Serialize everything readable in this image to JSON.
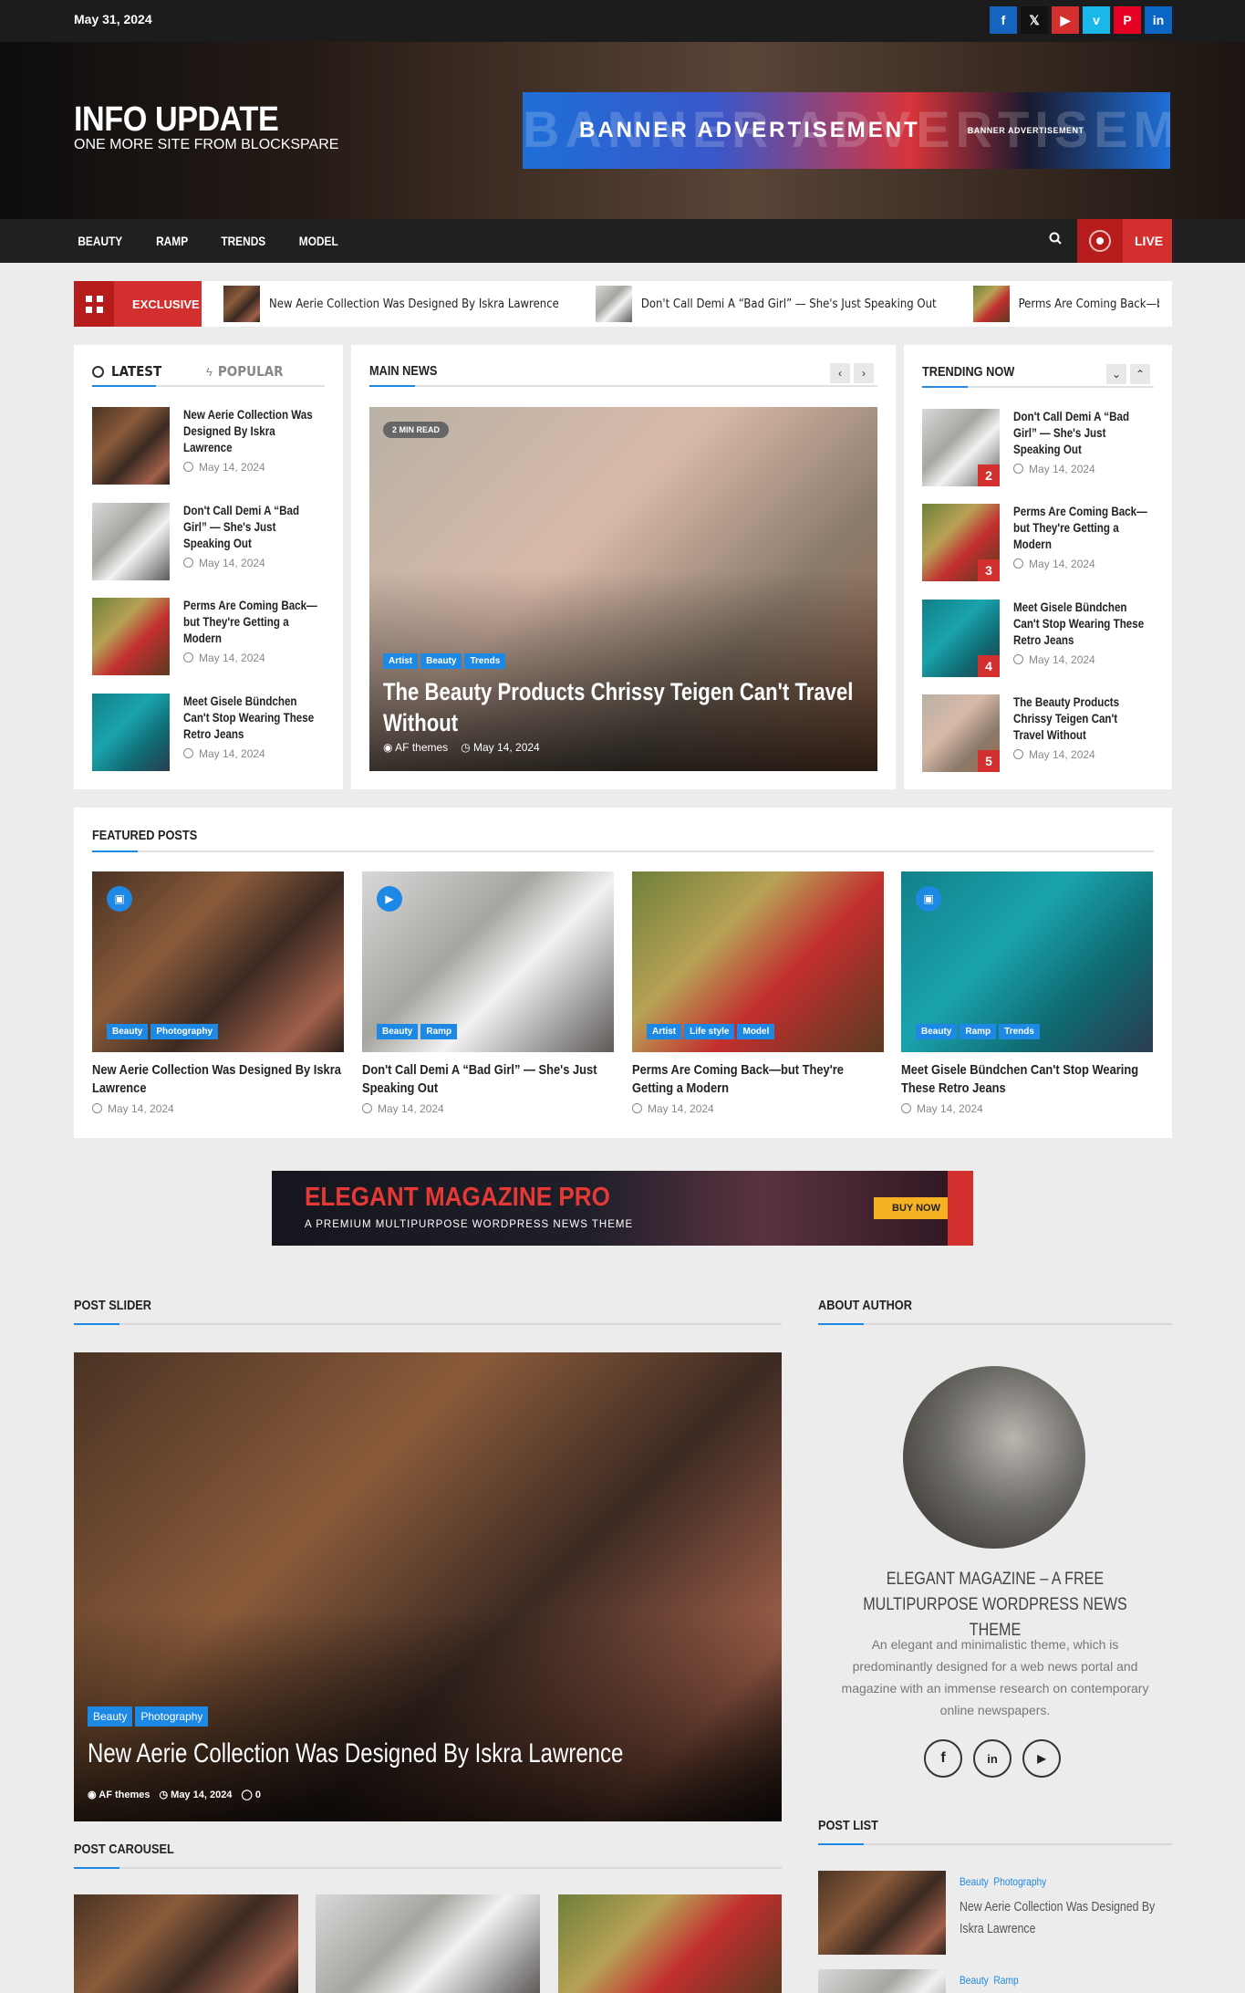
{
  "topbar": {
    "date": "May 31, 2024",
    "socials": [
      {
        "icon": "facebook-icon",
        "glyph": "f",
        "color": "#1565c0"
      },
      {
        "icon": "x-icon",
        "glyph": "𝕏",
        "color": "#111111"
      },
      {
        "icon": "youtube-icon",
        "glyph": "▶",
        "color": "#d32f2f"
      },
      {
        "icon": "vimeo-icon",
        "glyph": "v",
        "color": "#1ab7ea"
      },
      {
        "icon": "pinterest-icon",
        "glyph": "P",
        "color": "#e60023"
      },
      {
        "icon": "linkedin-icon",
        "glyph": "in",
        "color": "#0a66c2"
      }
    ]
  },
  "header": {
    "site_title": "INFO UPDATE",
    "tagline": "ONE MORE SITE FROM BLOCKSPARE",
    "banner": {
      "main": "BANNER ADVERTISEMENT",
      "small": "BANNER ADVERTISEMENT",
      "ghost": "BANNER ADVERTISEME"
    }
  },
  "nav": {
    "items": [
      "BEAUTY",
      "RAMP",
      "TRENDS",
      "MODEL"
    ],
    "live_label": "LIVE"
  },
  "exclusive": {
    "label": "EXCLUSIVE",
    "items": [
      "New Aerie Collection Was Designed By Iskra Lawrence",
      "Don't Call Demi A “Bad Girl” — She's Just Speaking Out",
      "Perms Are Coming Back—but They're Getting a Modern"
    ]
  },
  "latest": {
    "tab_latest": "LATEST",
    "tab_popular": "POPULAR",
    "items": [
      {
        "title": "New Aerie Collection Was Designed By Iskra Lawrence",
        "date": "May 14, 2024"
      },
      {
        "title": "Don't Call Demi A “Bad Girl” — She's Just Speaking Out",
        "date": "May 14, 2024"
      },
      {
        "title": "Perms Are Coming Back—but They're Getting a Modern",
        "date": "May 14, 2024"
      },
      {
        "title": "Meet Gisele Bündchen Can't Stop Wearing These Retro Jeans",
        "date": "May 14, 2024"
      }
    ]
  },
  "main_news": {
    "heading": "MAIN NEWS",
    "read_badge": "2 MIN READ",
    "tags": [
      "Artist",
      "Beauty",
      "Trends"
    ],
    "title": "The Beauty Products Chrissy Teigen Can't Travel Without",
    "author": "AF themes",
    "date": "May 14, 2024"
  },
  "trending": {
    "heading": "TRENDING NOW",
    "items": [
      {
        "num": "2",
        "title": "Don't Call Demi A “Bad Girl” — She's Just Speaking Out",
        "date": "May 14, 2024"
      },
      {
        "num": "3",
        "title": "Perms Are Coming Back—but They're Getting a Modern",
        "date": "May 14, 2024"
      },
      {
        "num": "4",
        "title": "Meet Gisele Bündchen Can't Stop Wearing These Retro Jeans",
        "date": "May 14, 2024"
      },
      {
        "num": "5",
        "title": "The Beauty Products Chrissy Teigen Can't Travel Without",
        "date": "May 14, 2024"
      }
    ]
  },
  "featured": {
    "heading": "FEATURED POSTS",
    "items": [
      {
        "tags": [
          "Beauty",
          "Photography"
        ],
        "title": "New Aerie Collection Was Designed By Iskra Lawrence",
        "date": "May 14, 2024",
        "icon": "image-icon",
        "glyph": "▣"
      },
      {
        "tags": [
          "Beauty",
          "Ramp"
        ],
        "title": "Don't Call Demi A “Bad Girl” — She's Just Speaking Out",
        "date": "May 14, 2024",
        "icon": "play-icon",
        "glyph": "▶"
      },
      {
        "tags": [
          "Artist",
          "Life style",
          "Model"
        ],
        "title": "Perms Are Coming Back—but They're Getting a Modern",
        "date": "May 14, 2024",
        "icon": "",
        "glyph": ""
      },
      {
        "tags": [
          "Beauty",
          "Ramp",
          "Trends"
        ],
        "title": "Meet Gisele Bündchen Can't Stop Wearing These Retro Jeans",
        "date": "May 14, 2024",
        "icon": "image-icon",
        "glyph": "▣"
      }
    ]
  },
  "promo": {
    "title": "ELEGANT MAGAZINE PRO",
    "subtitle": "A PREMIUM MULTIPURPOSE WORDPRESS NEWS THEME",
    "cta": "BUY NOW"
  },
  "post_slider": {
    "heading": "POST SLIDER",
    "tags": [
      "Beauty",
      "Photography"
    ],
    "title": "New Aerie Collection Was Designed By Iskra Lawrence",
    "author": "AF themes",
    "date": "May 14, 2024",
    "comments": "0"
  },
  "post_carousel": {
    "heading": "POST CAROUSEL"
  },
  "about": {
    "heading": "ABOUT AUTHOR",
    "title": "ELEGANT MAGAZINE – A FREE MULTIPURPOSE WORDPRESS NEWS THEME",
    "text": "An elegant and minimalistic theme, which is predominantly designed for a web news portal and magazine with an immense research on contemporary online newspapers."
  },
  "post_list": {
    "heading": "POST LIST",
    "items": [
      {
        "tags": "Beauty  Photography",
        "title": "New Aerie Collection Was Designed By Iskra Lawrence"
      },
      {
        "tags": "Beauty  Ramp",
        "title": ""
      }
    ]
  }
}
